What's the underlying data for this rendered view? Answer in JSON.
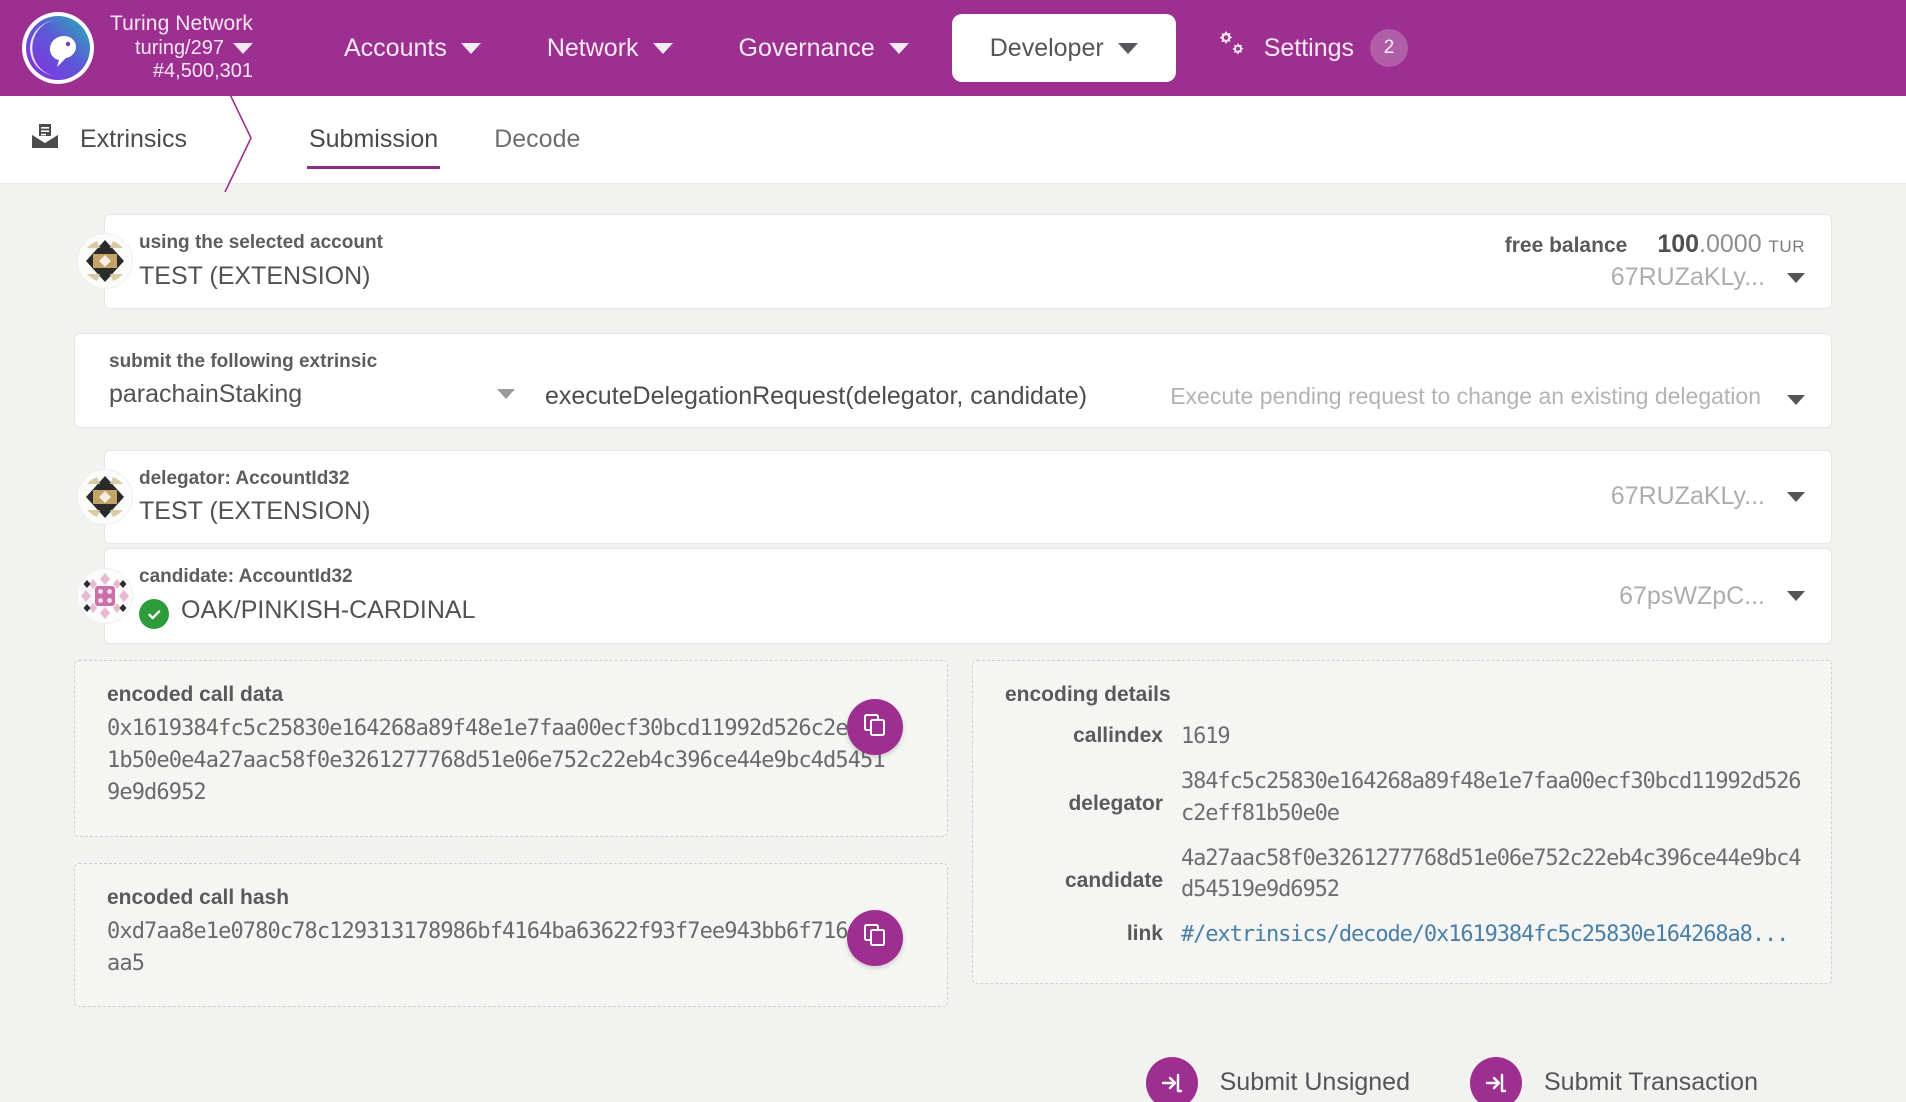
{
  "header": {
    "brand_name": "Turing Network",
    "chain": "turing/297",
    "block": "#4,500,301",
    "nav": [
      {
        "label": "Accounts",
        "icon": "chevron-down-icon",
        "active": false
      },
      {
        "label": "Network",
        "icon": "chevron-down-icon",
        "active": false
      },
      {
        "label": "Governance",
        "icon": "chevron-down-icon",
        "active": false
      },
      {
        "label": "Developer",
        "icon": "chevron-down-icon",
        "active": true
      }
    ],
    "settings": {
      "label": "Settings",
      "badge": "2",
      "icon": "gears-icon"
    },
    "accent": "#9c2f8f"
  },
  "subnav": {
    "section": "Extrinsics",
    "section_icon": "mail-open-icon",
    "tabs": [
      {
        "label": "Submission",
        "active": true
      },
      {
        "label": "Decode",
        "active": false
      }
    ]
  },
  "account_row": {
    "label": "using the selected account",
    "value": "TEST (EXTENSION)",
    "balance_label": "free balance",
    "balance_whole": "100",
    "balance_frac": ".0000",
    "balance_unit": "TUR",
    "address": "67RUZaKLy...",
    "identicon": "polkadot-identicon"
  },
  "extrinsic_row": {
    "label": "submit the following extrinsic",
    "pallet": "parachainStaking",
    "method": "executeDelegationRequest(delegator, candidate)",
    "description": "Execute pending request to change an existing delegation"
  },
  "params": [
    {
      "label": "delegator: AccountId32",
      "value": "TEST (EXTENSION)",
      "address": "67RUZaKLy...",
      "identicon": "polkadot-identicon",
      "verified": false
    },
    {
      "label": "candidate: AccountId32",
      "value": "OAK/PINKISH-CARDINAL",
      "address": "67psWZpC...",
      "identicon": "polkadot-identicon-pink",
      "verified": true
    }
  ],
  "encoded": [
    {
      "title": "encoded call data",
      "value": "0x1619384fc5c25830e164268a89f48e1e7faa00ecf30bcd11992d526c2eff81b50e0e4a27aac58f0e3261277768d51e06e752c22eb4c396ce44e9bc4d54519e9d6952",
      "copy_icon": "copy-icon"
    },
    {
      "title": "encoded call hash",
      "value": "0xd7aa8e1e0780c78c129313178986bf4164ba63622f93f7ee943bb6f716c5daa5",
      "copy_icon": "copy-icon"
    }
  ],
  "encoding_details": {
    "title": "encoding details",
    "rows": [
      {
        "key": "callindex",
        "value": "1619",
        "is_link": false
      },
      {
        "key": "delegator",
        "value": "384fc5c25830e164268a89f48e1e7faa00ecf30bcd11992d526c2eff81b50e0e",
        "is_link": false
      },
      {
        "key": "candidate",
        "value": "4a27aac58f0e3261277768d51e06e752c22eb4c396ce44e9bc4d54519e9d6952",
        "is_link": false
      },
      {
        "key": "link",
        "value": "#/extrinsics/decode/0x1619384fc5c25830e164268a8...",
        "is_link": true
      }
    ]
  },
  "footer": {
    "buttons": [
      {
        "label": "Submit Unsigned",
        "icon": "sign-in-icon"
      },
      {
        "label": "Submit Transaction",
        "icon": "sign-in-icon"
      }
    ]
  }
}
